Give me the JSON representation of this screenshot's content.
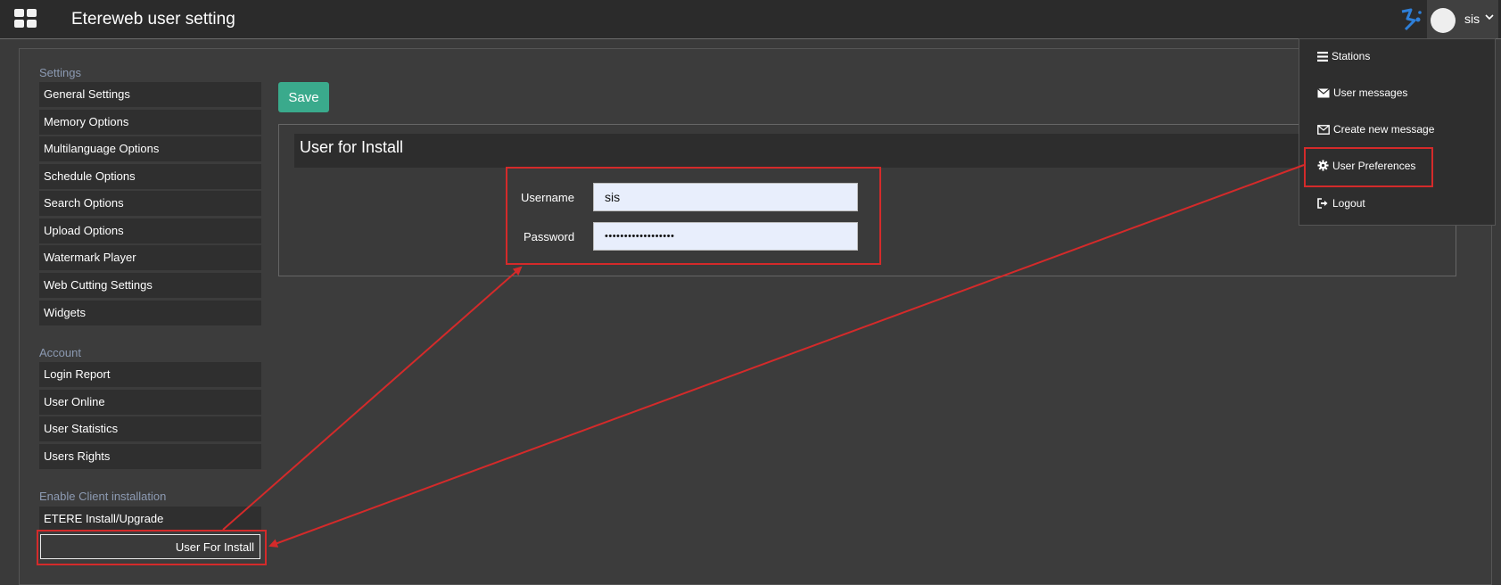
{
  "app": {
    "title": "Etereweb user setting"
  },
  "user": {
    "name": "sis"
  },
  "sidebar": {
    "settings_title": "Settings",
    "settings_items": [
      "General Settings",
      "Memory Options",
      "Multilanguage Options",
      "Schedule Options",
      "Search Options",
      "Upload Options",
      "Watermark Player",
      "Web Cutting Settings",
      "Widgets"
    ],
    "account_title": "Account",
    "account_items": [
      "Login Report",
      "User Online",
      "User Statistics",
      "Users Rights"
    ],
    "client_title": "Enable Client installation",
    "client_items": [
      "ETERE Install/Upgrade",
      "User For Install"
    ]
  },
  "toolbar": {
    "save_label": "Save"
  },
  "form": {
    "title": "User for Install",
    "username_label": "Username",
    "username_value": "sis",
    "password_label": "Password",
    "password_value": "••••••••••••••••••"
  },
  "dropdown": {
    "items": [
      "Stations",
      "User messages",
      "Create new message",
      "User Preferences",
      "Logout"
    ]
  },
  "colors": {
    "accent": "#3aaa8c",
    "annotation": "#d42a2a",
    "section_title": "#8c9ab2"
  }
}
